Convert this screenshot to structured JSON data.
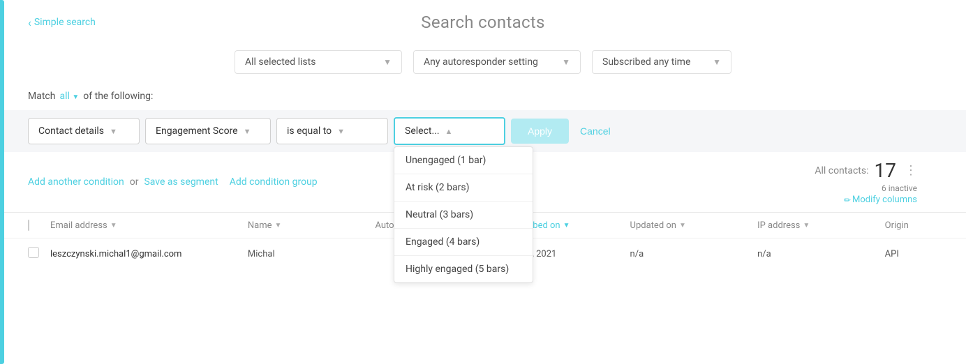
{
  "header": {
    "back_label": "Simple search",
    "title": "Search contacts"
  },
  "filters": {
    "lists_placeholder": "All selected lists",
    "autoresponder_placeholder": "Any autoresponder setting",
    "subscribed_placeholder": "Subscribed any time"
  },
  "match": {
    "prefix": "Match",
    "all_label": "all",
    "suffix": "of the following:"
  },
  "condition": {
    "category_label": "Contact details",
    "field_label": "Engagement Score",
    "operator_label": "is equal to",
    "value_placeholder": "Select...",
    "apply_label": "Apply",
    "cancel_label": "Cancel"
  },
  "dropdown": {
    "options": [
      "Unengaged (1 bar)",
      "At risk (2 bars)",
      "Neutral (3 bars)",
      "Engaged (4 bars)",
      "Highly engaged (5 bars)"
    ]
  },
  "actions": {
    "add_condition": "Add another condition",
    "separator": "or",
    "save_segment": "Save as segment",
    "add_group": "Add condition group"
  },
  "contacts": {
    "label": "All contacts:",
    "count": "17",
    "inactive_label": "6 inactive",
    "modify_label": "Modify columns"
  },
  "table": {
    "headers": [
      {
        "label": "Email address",
        "sort": true
      },
      {
        "label": "Name",
        "sort": true
      },
      {
        "label": "Autoresponder day",
        "sort": false
      },
      {
        "label": "Subscribed on",
        "sort": true,
        "active": true
      },
      {
        "label": "Updated on",
        "sort": true
      },
      {
        "label": "IP address",
        "sort": true
      },
      {
        "label": "Origin",
        "sort": false
      }
    ],
    "rows": [
      {
        "email": "leszczynski.michal1@gmail.com",
        "name": "Michal",
        "autoresponder": "",
        "subscribed": "May 14, 2021",
        "updated": "n/a",
        "ip": "n/a",
        "origin": "API"
      }
    ]
  }
}
